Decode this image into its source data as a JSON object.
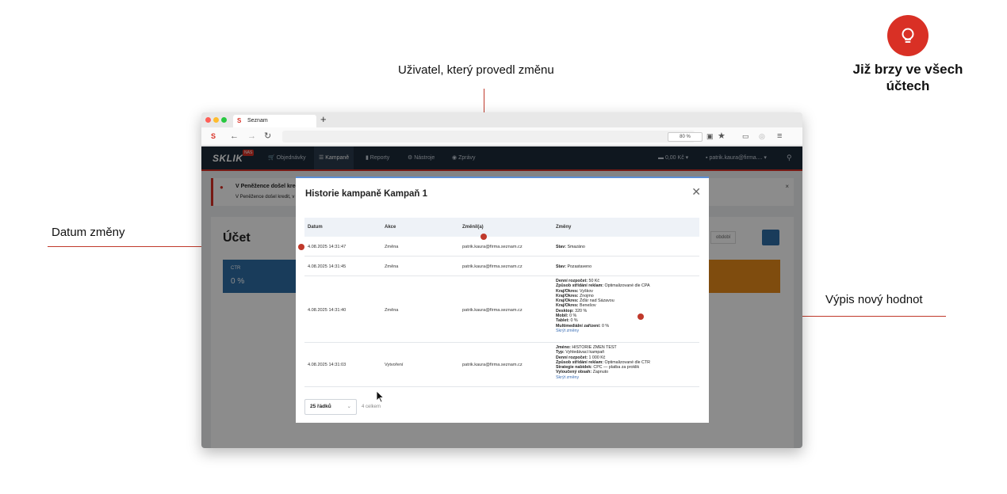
{
  "annotations": {
    "user_label": "Uživatel, který provedl změnu",
    "date_label": "Datum změny",
    "values_label": "Výpis nový hodnot",
    "soon_label": "Již brzy ve všech účtech"
  },
  "colors": {
    "accent": "#d93025",
    "nav": "#1d2b3a",
    "link": "#3b6fb6"
  },
  "browser": {
    "tab_title": "Seznam",
    "zoom": "80 %"
  },
  "app": {
    "logo": "SKLIK",
    "logo_badge": "NAS",
    "nav": [
      "Objednávky",
      "Kampaně",
      "Reporty",
      "Nástroje",
      "Zprávy"
    ],
    "credit": "0,00 Kč",
    "user": "patrik.kaura@firma....",
    "alert_title": "V Peněžence došel kredit",
    "alert_text": "V Peněžence došel kredit, v",
    "page_title": "Účet",
    "ctr_label": "CTR",
    "ctr_value": "0 %",
    "period_label": "období"
  },
  "modal": {
    "title": "Historie kampaně Kampaň 1",
    "columns": [
      "Datum",
      "Akce",
      "Změnil(a)",
      "Změny"
    ],
    "rows": [
      {
        "date": "4.08.2025 14:31:47",
        "action": "Změna",
        "user": "patrik.kaura@firma.seznam.cz",
        "changes": [
          {
            "k": "Stav:",
            "v": "Smazáno"
          }
        ]
      },
      {
        "date": "4.08.2025 14:31:45",
        "action": "Změna",
        "user": "patrik.kaura@firma.seznam.cz",
        "changes": [
          {
            "k": "Stav:",
            "v": "Pozastaveno"
          }
        ]
      },
      {
        "date": "4.08.2025 14:31:40",
        "action": "Změna",
        "user": "patrik.kaura@firma.seznam.cz",
        "changes": [
          {
            "k": "Denní rozpočet:",
            "v": "50 Kč"
          },
          {
            "k": "Způsob střídání reklam:",
            "v": "Optimalizované dle CPA"
          },
          {
            "k": "Kraj/Okres:",
            "v": "Vyškov"
          },
          {
            "k": "Kraj/Okres:",
            "v": "Znojmo"
          },
          {
            "k": "Kraj/Okres:",
            "v": "Žďár nad Sázavou"
          },
          {
            "k": "Kraj/Okres:",
            "v": "Benešov"
          },
          {
            "k": "Desktop:",
            "v": "320 %"
          },
          {
            "k": "Mobil:",
            "v": "0 %"
          },
          {
            "k": "Tablet:",
            "v": "0 %"
          },
          {
            "k": "Multimediální zařízení:",
            "v": "0 %"
          }
        ],
        "hide": "Skrýt změny"
      },
      {
        "date": "4.08.2025 14:31:03",
        "action": "Vytvoření",
        "user": "patrik.kaura@firma.seznam.cz",
        "changes": [
          {
            "k": "Jméno:",
            "v": "HISTORIE ZMEN TEST"
          },
          {
            "k": "Typ:",
            "v": "Vyhledávací kampaň"
          },
          {
            "k": "Denní rozpočet:",
            "v": "1 000 Kč"
          },
          {
            "k": "Způsob střídání reklam:",
            "v": "Optimalizované dle CTR"
          },
          {
            "k": "Strategie nabídek:",
            "v": "CPC — platba za proklik"
          },
          {
            "k": "Vyloučený obsah:",
            "v": "Zapnuto"
          }
        ],
        "hide": "Skrýt změny"
      }
    ],
    "page_size": "25 řádků",
    "total": "4 celkem"
  }
}
